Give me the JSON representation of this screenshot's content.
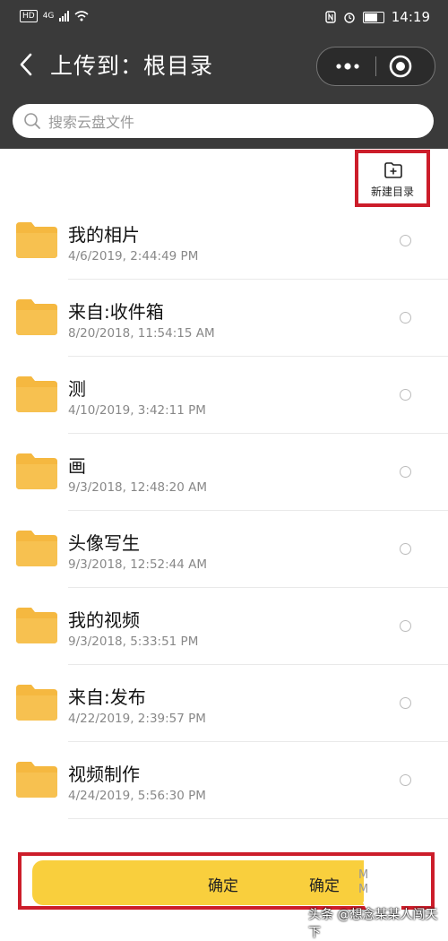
{
  "status_bar": {
    "hd": "HD",
    "network": "4G",
    "time": "14:19"
  },
  "header": {
    "title": "上传到：根目录"
  },
  "search": {
    "placeholder": "搜索云盘文件"
  },
  "toolbar": {
    "new_folder_label": "新建目录"
  },
  "colors": {
    "header_bg": "#3a3a3a",
    "folder": "#f5b840",
    "confirm": "#f9cf3d",
    "highlight_border": "#cc1d2a"
  },
  "files": [
    {
      "name": "我的相片",
      "time": "4/6/2019, 2:44:49 PM"
    },
    {
      "name": "来自:收件箱",
      "time": "8/20/2018, 11:54:15 AM"
    },
    {
      "name": "测",
      "time": "4/10/2019, 3:42:11 PM"
    },
    {
      "name": "画",
      "time": "9/3/2018, 12:48:20 AM"
    },
    {
      "name": "头像写生",
      "time": "9/3/2018, 12:52:44 AM"
    },
    {
      "name": "我的视频",
      "time": "9/3/2018, 5:33:51 PM"
    },
    {
      "name": "来自:发布",
      "time": "4/22/2019, 2:39:57 PM"
    },
    {
      "name": "视频制作",
      "time": "4/24/2019, 5:56:30 PM"
    }
  ],
  "footer": {
    "confirm_label": "确定",
    "confirm_label_dup": "确定",
    "ghost_text_1": "M",
    "ghost_text_2": "M"
  },
  "watermark": "头条 @想念某某人闯天下"
}
